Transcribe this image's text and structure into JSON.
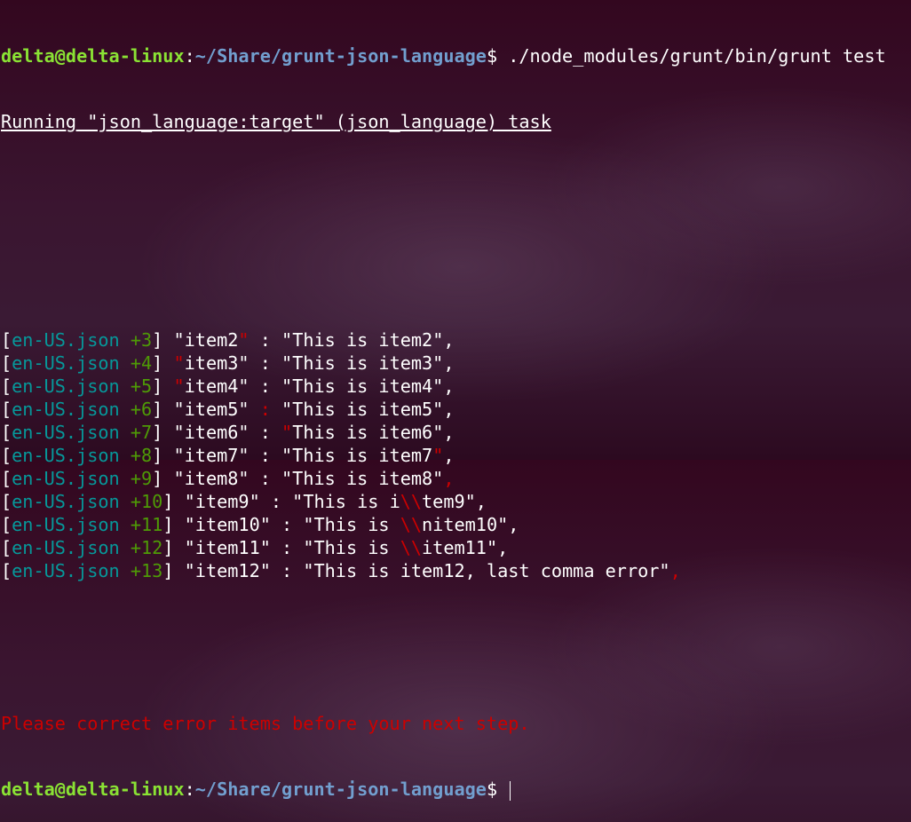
{
  "prompt": {
    "user_host": "delta@delta-linux",
    "colon": ":",
    "path": "~/Share/grunt-json-language",
    "dollar": "$ ",
    "command": "./node_modules/grunt/bin/grunt test"
  },
  "task_line": "Running \"json_language:target\" (json_language) task",
  "rows": [
    {
      "file": "en-US.json",
      "num": "+3",
      "seg": [
        "\"item2",
        "\"",
        " : \"This is item2\","
      ]
    },
    {
      "file": "en-US.json",
      "num": "+4",
      "seg": [
        "",
        "\"",
        "item3\" : \"This is item3\","
      ]
    },
    {
      "file": "en-US.json",
      "num": "+5",
      "seg": [
        "",
        "\"",
        "item4\" : \"This is item4\","
      ]
    },
    {
      "file": "en-US.json",
      "num": "+6",
      "seg": [
        "\"item5\" ",
        ":",
        " \"This is item5\","
      ]
    },
    {
      "file": "en-US.json",
      "num": "+7",
      "seg": [
        "\"item6\" : ",
        "\"",
        "This is item6\","
      ]
    },
    {
      "file": "en-US.json",
      "num": "+8",
      "seg": [
        "\"item7\" : \"This is item7",
        "\"",
        ","
      ]
    },
    {
      "file": "en-US.json",
      "num": "+9",
      "seg": [
        "\"item8\" : \"This is item8\"",
        ",",
        ""
      ]
    },
    {
      "file": "en-US.json",
      "num": "+10",
      "seg": [
        "\"item9\" : \"This is i",
        "\\\\",
        "tem9\","
      ]
    },
    {
      "file": "en-US.json",
      "num": "+11",
      "seg": [
        "\"item10\" : \"This is ",
        "\\\\",
        "nitem10\","
      ]
    },
    {
      "file": "en-US.json",
      "num": "+12",
      "seg": [
        "\"item11\" : \"This is ",
        "\\\\",
        "item11\","
      ]
    },
    {
      "file": "en-US.json",
      "num": "+13",
      "seg": [
        "\"item12\" : \"This is item12, last comma error\"",
        ",",
        ""
      ]
    }
  ],
  "error_message": "Please correct error items before your next step.",
  "colors": {
    "prompt_user": "#8ae234",
    "prompt_path": "#729fcf",
    "file": "#06989a",
    "line_number": "#4e9a06",
    "error": "#cc0000"
  }
}
